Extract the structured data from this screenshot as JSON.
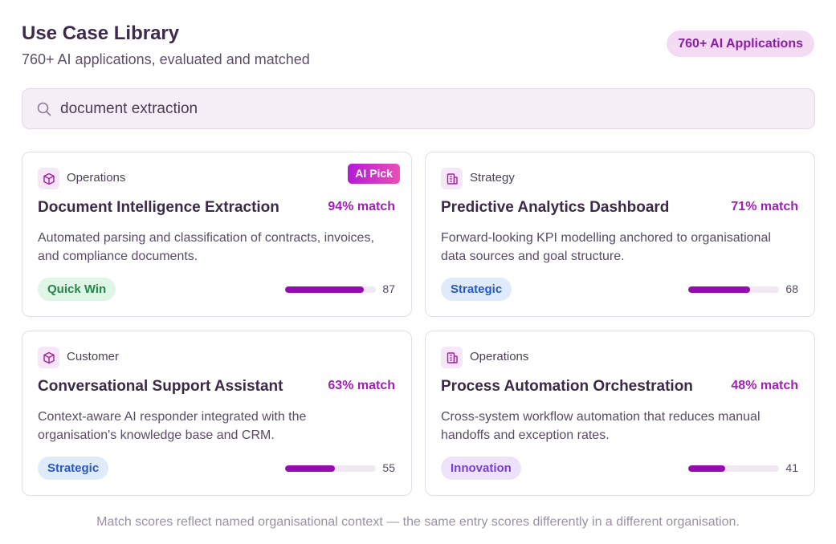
{
  "header": {
    "title": "Use Case Library",
    "subtitle": "760+ AI applications, evaluated and matched",
    "badge": "760+ AI Applications"
  },
  "search": {
    "value": "document extraction",
    "icon": "search-icon"
  },
  "colors": {
    "accent": "#960bb0",
    "match_text": "#a11fb6",
    "quick_win": "#23864a",
    "strategic": "#2758c9",
    "innovation": "#7a3cd0"
  },
  "cards": [
    {
      "category": "Operations",
      "icon": "cube-icon",
      "pick": "AI Pick",
      "title": "Document Intelligence Extraction",
      "match": "94% match",
      "description": "Automated parsing and classification of contracts, invoices, and compliance documents.",
      "tag": "Quick Win",
      "score": 87
    },
    {
      "category": "Strategy",
      "icon": "building-icon",
      "title": "Predictive Analytics Dashboard",
      "match": "71% match",
      "description": "Forward-looking KPI modelling anchored to organisational data sources and goal structure.",
      "tag": "Strategic",
      "score": 68
    },
    {
      "category": "Customer",
      "icon": "cube-icon",
      "title": "Conversational Support Assistant",
      "match": "63% match",
      "description": "Context-aware AI responder integrated with the organisation's knowledge base and CRM.",
      "tag": "Strategic",
      "score": 55
    },
    {
      "category": "Operations",
      "icon": "building-icon",
      "title": "Process Automation Orchestration",
      "match": "48% match",
      "description": "Cross-system workflow automation that reduces manual handoffs and exception rates.",
      "tag": "Innovation",
      "score": 41
    }
  ],
  "footer": "Match scores reflect named organisational context — the same entry scores differently in a different organisation."
}
